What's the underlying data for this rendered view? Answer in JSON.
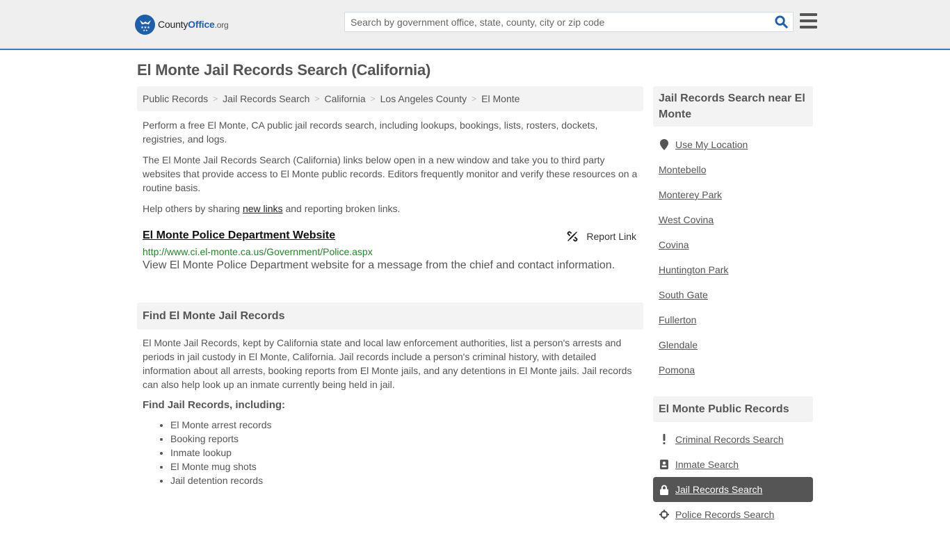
{
  "header": {
    "logo": {
      "brand_prefix": "County",
      "brand_main": "Office",
      "brand_suffix": ".org"
    },
    "search": {
      "placeholder": "Search by government office, state, county, city or zip code",
      "value": ""
    },
    "icons": {
      "search": "search-icon",
      "menu": "hamburger-menu-icon"
    }
  },
  "page": {
    "title": "El Monte Jail Records Search (California)"
  },
  "breadcrumb": [
    {
      "label": "Public Records"
    },
    {
      "label": "Jail Records Search"
    },
    {
      "label": "California"
    },
    {
      "label": "Los Angeles County"
    },
    {
      "label": "El Monte"
    }
  ],
  "intro": {
    "p1": "Perform a free El Monte, CA public jail records search, including lookups, bookings, lists, rosters, dockets, registries, and logs.",
    "p2": "The El Monte Jail Records Search (California) links below open in a new window and take you to third party websites that provide access to El Monte public records. Editors frequently monitor and verify these resources on a routine basis.",
    "p3_before": "Help others by sharing ",
    "p3_link": "new links",
    "p3_after": " and reporting broken links."
  },
  "listing": {
    "title": "El Monte Police Department Website",
    "url": "http://www.ci.el-monte.ca.us/Government/Police.aspx",
    "description": "View El Monte Police Department website for a message from the chief and contact information.",
    "report_label": "Report Link",
    "report_icon": "broken-link-icon"
  },
  "find_section": {
    "heading": "Find El Monte Jail Records",
    "body": "El Monte Jail Records, kept by California state and local law enforcement authorities, list a person's arrests and periods in jail custody in El Monte, California. Jail records include a person's criminal history, with detailed information about all arrests, booking reports from El Monte jails, and any detentions in El Monte jails. Jail records can also help look up an inmate currently being held in jail.",
    "subheading": "Find Jail Records, including:",
    "items": [
      "El Monte arrest records",
      "Booking reports",
      "Inmate lookup",
      "El Monte mug shots",
      "Jail detention records"
    ]
  },
  "sidebar": {
    "nearby": {
      "heading": "Jail Records Search near El Monte",
      "location_label": "Use My Location",
      "location_icon": "map-marker-icon",
      "cities": [
        "Montebello",
        "Monterey Park",
        "West Covina",
        "Covina",
        "Huntington Park",
        "South Gate",
        "Fullerton",
        "Glendale",
        "Pomona"
      ]
    },
    "public_records": {
      "heading": "El Monte Public Records",
      "items": [
        {
          "label": "Criminal Records Search",
          "icon": "exclamation-icon",
          "active": false
        },
        {
          "label": "Inmate Search",
          "icon": "id-badge-icon",
          "active": false
        },
        {
          "label": "Jail Records Search",
          "icon": "lock-icon",
          "active": true
        },
        {
          "label": "Police Records Search",
          "icon": "crosshairs-icon",
          "active": false
        }
      ]
    }
  },
  "colors": {
    "header_bg": "#efefef",
    "header_border": "#3b7fb6",
    "brand_blue": "#1f5fa8",
    "text": "#555555",
    "url_green": "#2e7d32",
    "panel_bg": "#f3f3f3",
    "active_bg": "#555555"
  }
}
